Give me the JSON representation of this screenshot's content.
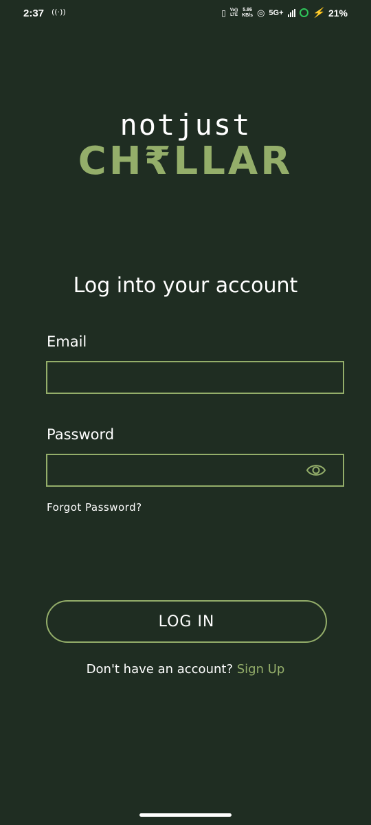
{
  "status_bar": {
    "time": "2:37",
    "hotspot_icon": "hotspot-icon",
    "volte_top": "Vo))",
    "volte_bottom": "LTE",
    "speed_value": "5.86",
    "speed_unit": "KB/s",
    "network": "5G+",
    "battery": "21%",
    "charging_color": "#ffc928",
    "ring_color": "#2ec55a"
  },
  "logo": {
    "top": "notjust",
    "bottom": "CH₹LLAR"
  },
  "heading": "Log into your account",
  "form": {
    "email_label": "Email",
    "email_value": "",
    "password_label": "Password",
    "password_value": "",
    "forgot_password": "Forgot Password?"
  },
  "login_button": "LOG IN",
  "signup": {
    "prompt": "Don't have an account?",
    "link": "Sign Up"
  },
  "colors": {
    "background": "#1f2d22",
    "accent": "#94ae6a",
    "text": "#ffffff"
  }
}
